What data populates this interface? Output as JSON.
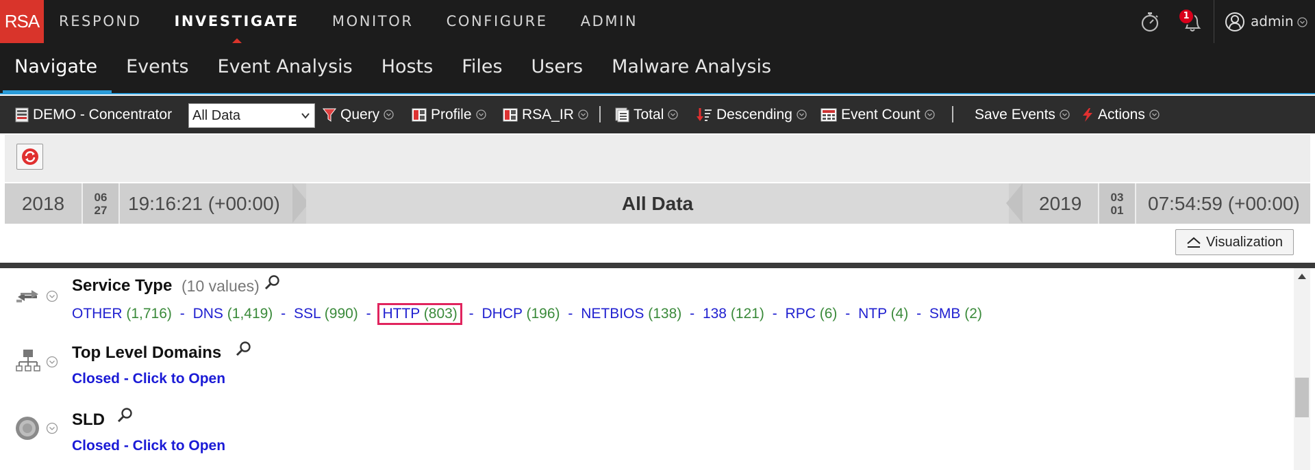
{
  "brand": {
    "logo": "RSA",
    "color": "#d9342b"
  },
  "top_nav": {
    "items": [
      "RESPOND",
      "INVESTIGATE",
      "MONITOR",
      "CONFIGURE",
      "ADMIN"
    ],
    "active": "INVESTIGATE"
  },
  "header_right": {
    "notifications_count": "1",
    "username": "admin"
  },
  "sub_nav": {
    "tabs": [
      "Navigate",
      "Events",
      "Event Analysis",
      "Hosts",
      "Files",
      "Users",
      "Malware Analysis"
    ],
    "active": "Navigate",
    "accent": "#2a9bd8"
  },
  "toolbar": {
    "service": "DEMO - Concentrator",
    "time_range_selected": "All Data",
    "query": "Query",
    "profile": "Profile",
    "meta_group": "RSA_IR",
    "total": "Total",
    "order": "Descending",
    "event_count": "Event Count",
    "save_events": "Save Events",
    "actions": "Actions"
  },
  "timeline": {
    "start_year": "2018",
    "start_month": "06",
    "start_day": "27",
    "start_time": "19:16:21 (+00:00)",
    "center_label": "All Data",
    "end_year": "2019",
    "end_month": "03",
    "end_day": "01",
    "end_time": "07:54:59 (+00:00)"
  },
  "visualization_button": "Visualization",
  "meta_keys": [
    {
      "title": "Service Type",
      "count_label": "(10 values)",
      "icon": "service-type-arrows-icon",
      "values": [
        {
          "name": "OTHER",
          "count": "(1,716)"
        },
        {
          "name": "DNS",
          "count": "(1,419)"
        },
        {
          "name": "SSL",
          "count": "(990)"
        },
        {
          "name": "HTTP",
          "count": "(803)"
        },
        {
          "name": "DHCP",
          "count": "(196)"
        },
        {
          "name": "NETBIOS",
          "count": "(138)"
        },
        {
          "name": "138",
          "count": "(121)"
        },
        {
          "name": "RPC",
          "count": "(6)"
        },
        {
          "name": "NTP",
          "count": "(4)"
        },
        {
          "name": "SMB",
          "count": "(2)"
        }
      ],
      "highlighted": "HTTP"
    },
    {
      "title": "Top Level Domains",
      "icon": "network-tree-icon",
      "state": "Closed - Click to Open"
    },
    {
      "title": "SLD",
      "icon": "globe-badge-icon",
      "state": "Closed - Click to Open"
    }
  ]
}
